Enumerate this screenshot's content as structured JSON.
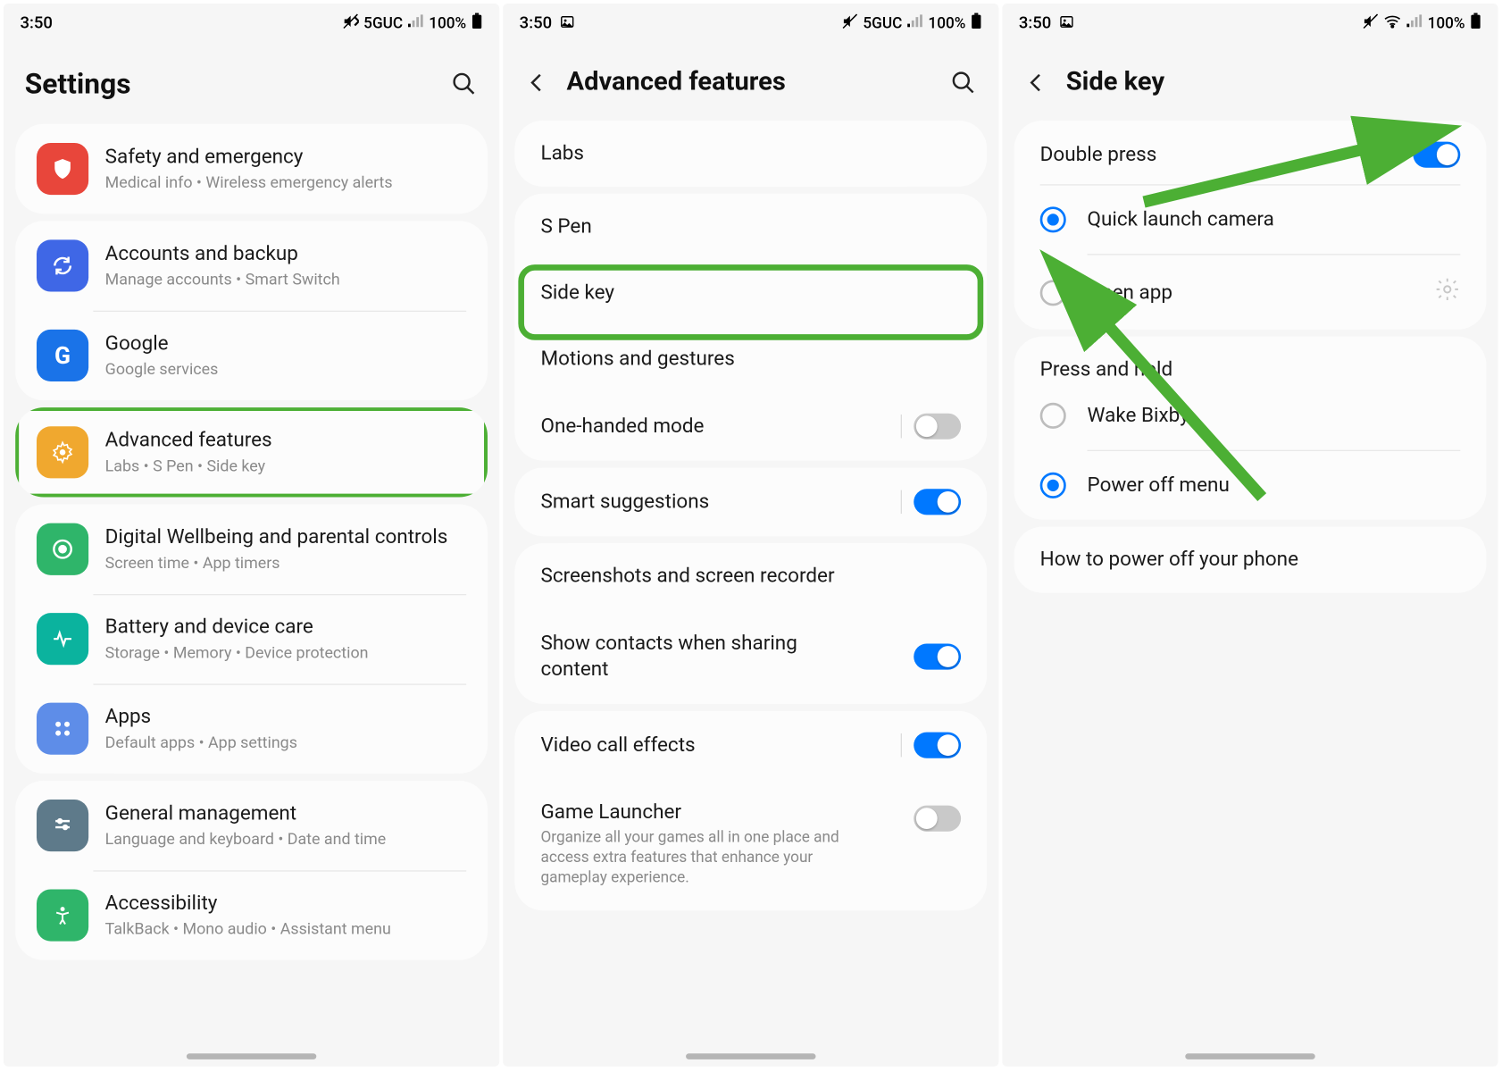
{
  "status": {
    "time": "3:50",
    "network": "5GUC",
    "battery": "100%"
  },
  "screen1": {
    "title": "Settings",
    "items": [
      {
        "title": "Safety and emergency",
        "sub": "Medical info  •  Wireless emergency alerts",
        "color": "#e8463b",
        "icon": "shield"
      },
      {
        "title": "Accounts and backup",
        "sub": "Manage accounts  •  Smart Switch",
        "color": "#3f67e6",
        "icon": "sync"
      },
      {
        "title": "Google",
        "sub": "Google services",
        "color": "#1a73e8",
        "icon": "g"
      },
      {
        "title": "Advanced features",
        "sub": "Labs  •  S Pen  •  Side key",
        "color": "#f0a82f",
        "icon": "gear"
      },
      {
        "title": "Digital Wellbeing and parental controls",
        "sub": "Screen time  •  App timers",
        "color": "#2fb56a",
        "icon": "target"
      },
      {
        "title": "Battery and device care",
        "sub": "Storage  •  Memory  •  Device protection",
        "color": "#0bb39e",
        "icon": "pulse"
      },
      {
        "title": "Apps",
        "sub": "Default apps  •  App settings",
        "color": "#5e8de8",
        "icon": "grid"
      },
      {
        "title": "General management",
        "sub": "Language and keyboard  •  Date and time",
        "color": "#5e7a8a",
        "icon": "sliders"
      },
      {
        "title": "Accessibility",
        "sub": "TalkBack  •  Mono audio  •  Assistant menu",
        "color": "#2fb56a",
        "icon": "person"
      }
    ]
  },
  "screen2": {
    "title": "Advanced features",
    "groups": [
      [
        {
          "label": "Labs"
        }
      ],
      [
        {
          "label": "S Pen"
        },
        {
          "label": "Side key"
        },
        {
          "label": "Motions and gestures"
        },
        {
          "label": "One-handed mode",
          "toggle": "off"
        }
      ],
      [
        {
          "label": "Smart suggestions",
          "toggle": "on",
          "bar": true
        }
      ],
      [
        {
          "label": "Screenshots and screen recorder"
        },
        {
          "label": "Show contacts when sharing content",
          "toggle": "on"
        }
      ],
      [
        {
          "label": "Video call effects",
          "toggle": "on",
          "bar": true
        },
        {
          "label": "Game Launcher",
          "sub": "Organize all your games all in one place and access extra features that enhance your gameplay experience.",
          "toggle": "off"
        }
      ]
    ]
  },
  "screen3": {
    "title": "Side key",
    "doublePress": {
      "header": "Double press",
      "toggle": "on",
      "options": [
        {
          "label": "Quick launch camera",
          "selected": true
        },
        {
          "label": "Open app",
          "selected": false,
          "gear": true
        }
      ]
    },
    "pressHold": {
      "header": "Press and hold",
      "options": [
        {
          "label": "Wake Bixby",
          "selected": false
        },
        {
          "label": "Power off menu",
          "selected": true
        }
      ]
    },
    "footer": "How to power off your phone"
  }
}
